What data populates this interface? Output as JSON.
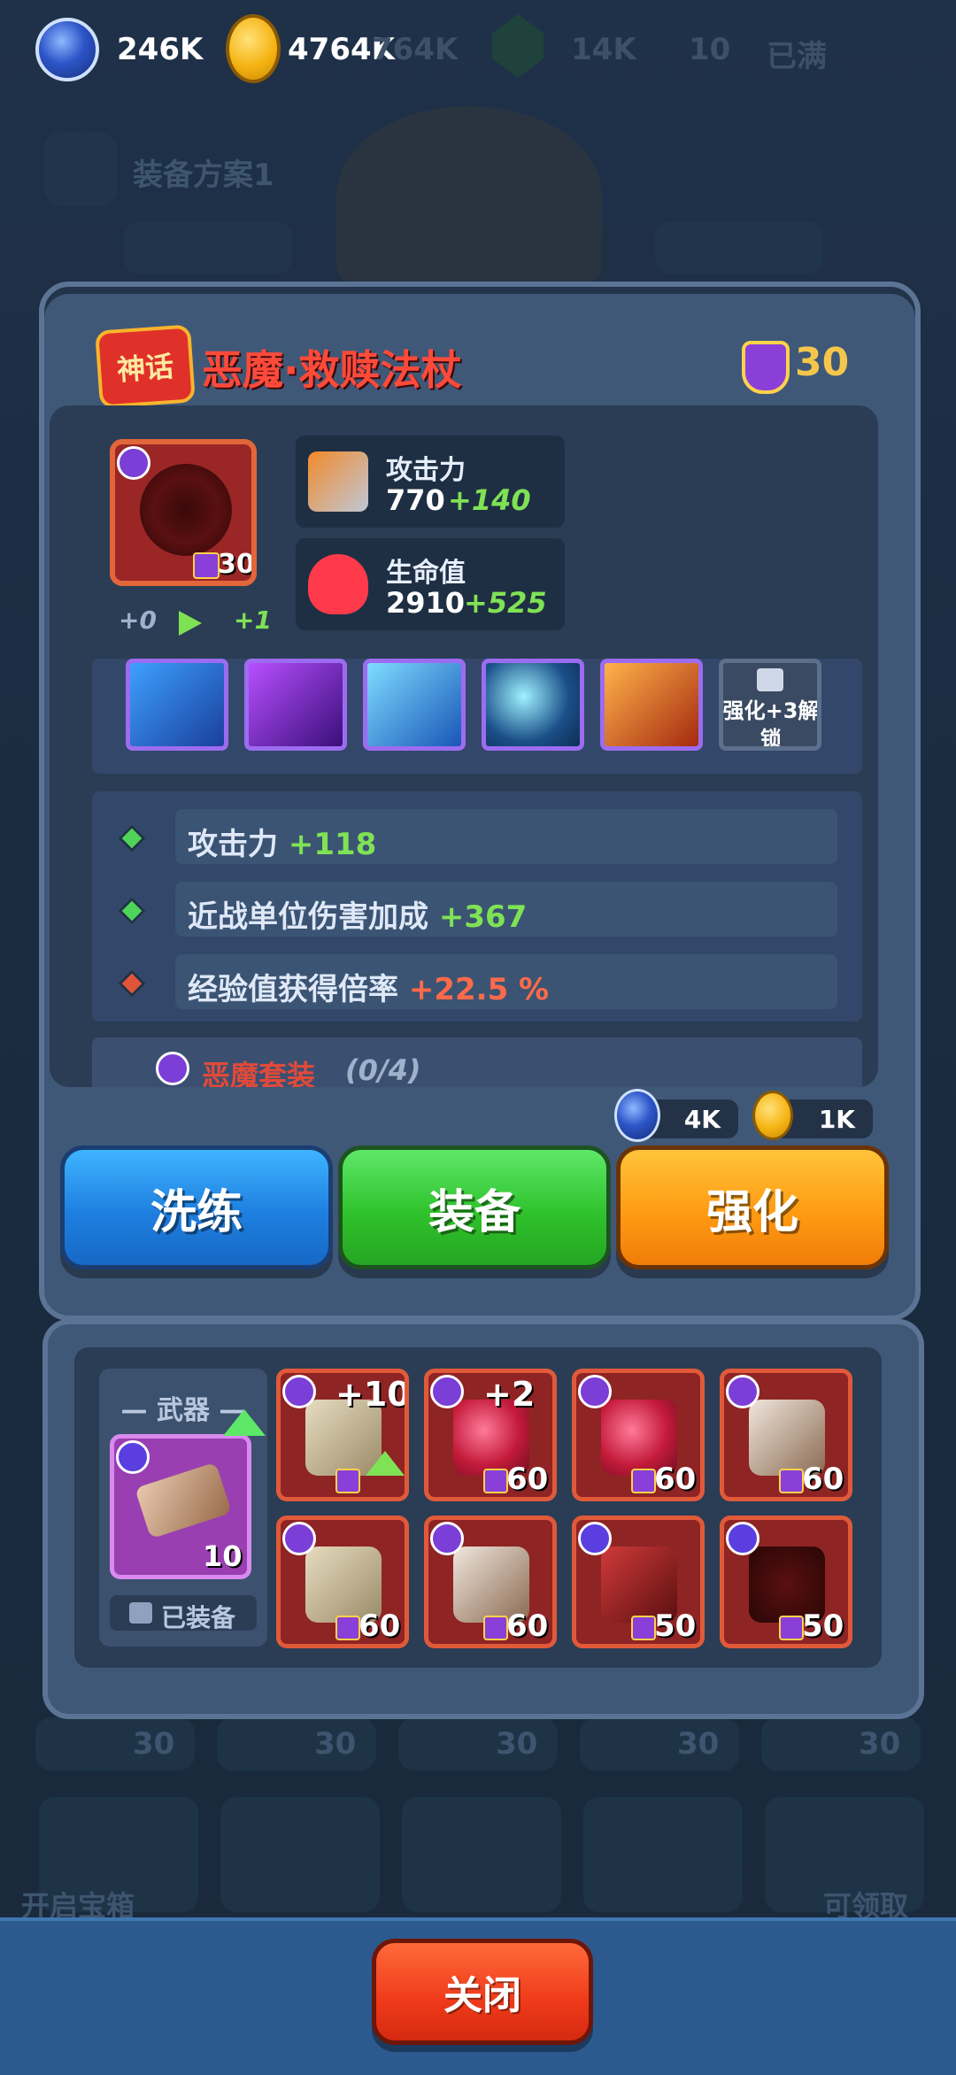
{
  "currency": {
    "essence": "246K",
    "gold": "4764K",
    "dim_values": [
      "764K",
      "14K",
      "10",
      "已满"
    ]
  },
  "background": {
    "plan_label": "装备方案1",
    "open_chest": "开启宝箱",
    "claimable": "可领取",
    "bg_levels": [
      "30",
      "30",
      "30",
      "30",
      "30"
    ]
  },
  "item": {
    "rarity_badge": "神话",
    "name": "恶魔·救赎法杖",
    "level_required": "30",
    "card_level": "30",
    "upgrade_from": "+0",
    "upgrade_to": "+1",
    "stats": [
      {
        "label": "攻击力",
        "value": "770",
        "bonus": "+140",
        "icon": "sword-icon"
      },
      {
        "label": "生命值",
        "value": "2910",
        "bonus": "+525",
        "icon": "heart-icon"
      }
    ],
    "locked_skill_text": "强化+3解锁",
    "attributes": [
      {
        "name": "攻击力",
        "value": "+118",
        "color": "#7fe255"
      },
      {
        "name": "近战单位伤害加成",
        "value": "+367",
        "color": "#7fe255"
      },
      {
        "name": "经验值获得倍率",
        "value": "+22.5 %",
        "color": "#ff6a4a"
      }
    ],
    "set_name": "恶魔套装",
    "set_progress": "(0/4)"
  },
  "costs": {
    "essence": "4K",
    "gold": "1K"
  },
  "buttons": {
    "reroll": "洗练",
    "equip": "装备",
    "enhance": "强化",
    "close": "关闭"
  },
  "inventory": {
    "slot_title": "— 武器 —",
    "equipped_label": "已装备",
    "equipped_level": "10",
    "items": [
      {
        "plus": "+10",
        "level": "",
        "kind": "book-icon",
        "badge": "demon"
      },
      {
        "plus": "+2",
        "level": "60",
        "kind": "orb-staff-icon",
        "badge": "demon"
      },
      {
        "plus": "",
        "level": "60",
        "kind": "orb-staff-icon",
        "badge": "demon"
      },
      {
        "plus": "",
        "level": "60",
        "kind": "crossbow-icon",
        "badge": "demon"
      },
      {
        "plus": "",
        "level": "60",
        "kind": "book-icon",
        "badge": "demon"
      },
      {
        "plus": "",
        "level": "60",
        "kind": "crossbow-icon",
        "badge": "demon"
      },
      {
        "plus": "",
        "level": "50",
        "kind": "tome-icon",
        "badge": "lightning"
      },
      {
        "plus": "",
        "level": "50",
        "kind": "mace-icon",
        "badge": "lightning"
      }
    ]
  }
}
